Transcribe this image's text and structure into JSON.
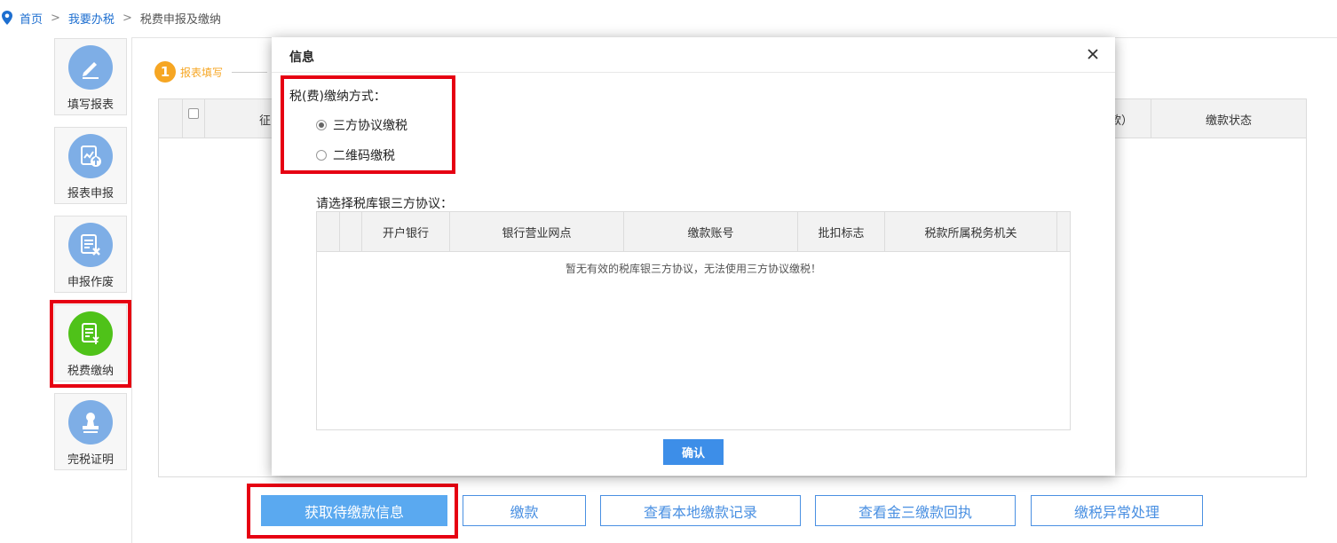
{
  "breadcrumb": {
    "home": "首页",
    "section": "我要办税",
    "current": "税费申报及缴纳",
    "separator": ">"
  },
  "sidenav": {
    "items": [
      {
        "label": "填写报表",
        "icon": "pencil-icon"
      },
      {
        "label": "报表申报",
        "icon": "report-upload-icon"
      },
      {
        "label": "申报作废",
        "icon": "document-cancel-icon"
      },
      {
        "label": "税费缴纳",
        "icon": "tax-payment-icon"
      },
      {
        "label": "完税证明",
        "icon": "stamp-icon"
      }
    ]
  },
  "step": {
    "number": "1",
    "label": "报表填写"
  },
  "bg_table": {
    "col_partial_left": "征",
    "col_partial_right": "款）",
    "col_status": "缴款状态"
  },
  "buttons": {
    "fetch": "获取待缴款信息",
    "pay": "缴款",
    "local_records": "查看本地缴款记录",
    "jinsan_receipt": "查看金三缴款回执",
    "exception": "缴税异常处理"
  },
  "modal": {
    "title": "信息",
    "pay_method_label": "税(费)缴纳方式：",
    "options": [
      {
        "label": "三方协议缴税",
        "selected": true
      },
      {
        "label": "二维码缴税",
        "selected": false
      }
    ],
    "protocol_label": "请选择税库银三方协议：",
    "columns": [
      "开户银行",
      "银行营业网点",
      "缴款账号",
      "批扣标志",
      "税款所属税务机关"
    ],
    "empty_message": "暂无有效的税库银三方协议，无法使用三方协议缴税！",
    "confirm": "确认"
  },
  "colors": {
    "accent": "#4a90e2",
    "highlight": "#e60012",
    "step": "#f6a623",
    "active_nav": "#4fc219",
    "nav_icon": "#7eaee6"
  }
}
